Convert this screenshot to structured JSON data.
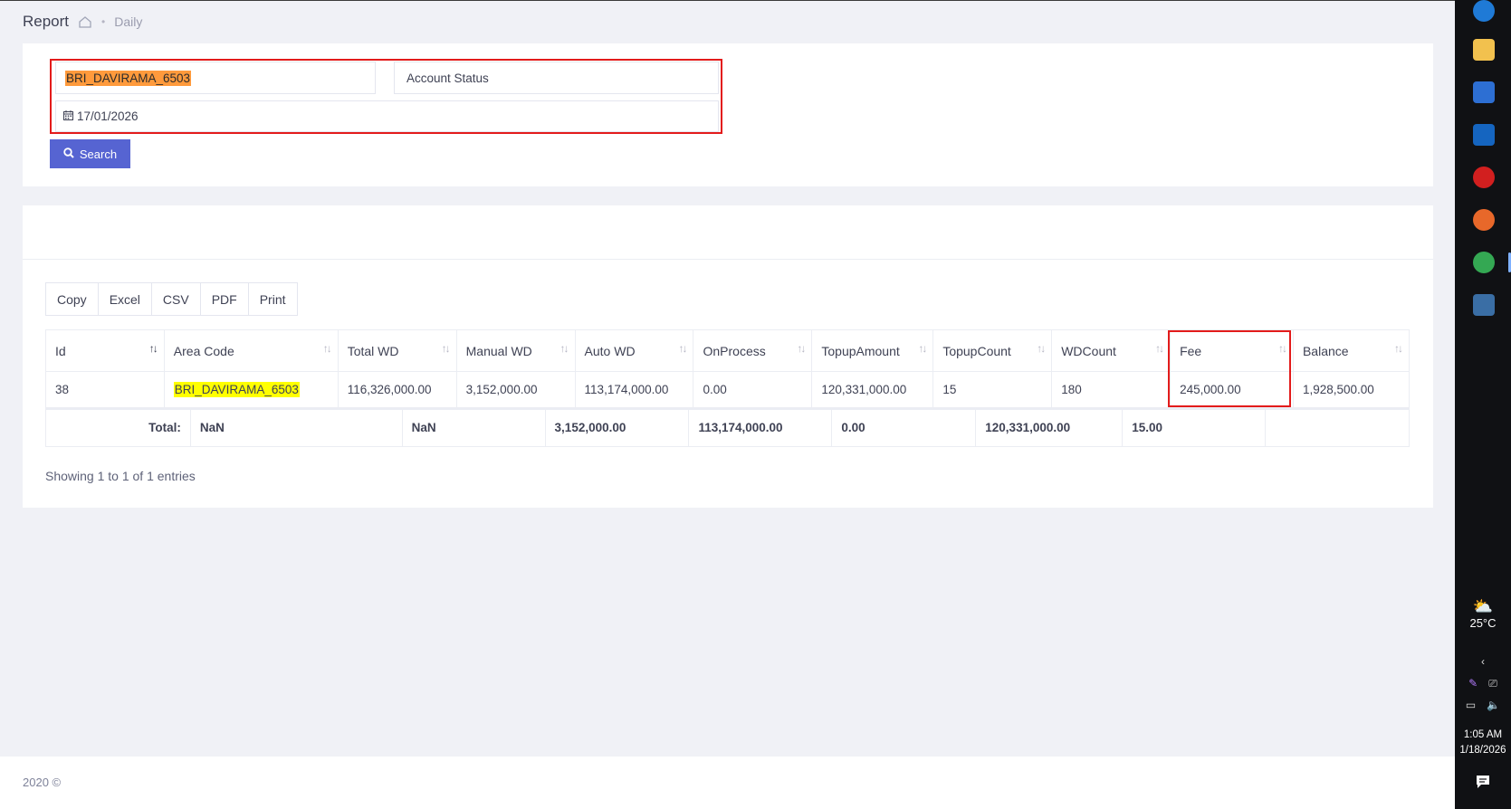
{
  "header": {
    "title": "Report",
    "breadcrumb": "Daily"
  },
  "filters": {
    "area_code": "BRI_DAVIRAMA_6503",
    "account_status": "Account Status",
    "date": "17/01/2026",
    "search_label": "Search"
  },
  "export_buttons": [
    "Copy",
    "Excel",
    "CSV",
    "PDF",
    "Print"
  ],
  "table": {
    "columns": [
      "Id",
      "Area Code",
      "Total WD",
      "Manual WD",
      "Auto WD",
      "OnProcess",
      "TopupAmount",
      "TopupCount",
      "WDCount",
      "Fee",
      "Balance"
    ],
    "rows": [
      [
        "38",
        "BRI_DAVIRAMA_6503",
        "116,326,000.00",
        "3,152,000.00",
        "113,174,000.00",
        "0.00",
        "120,331,000.00",
        "15",
        "180",
        "245,000.00",
        "1,928,500.00"
      ]
    ],
    "totals": {
      "label": "Total:",
      "values": [
        "NaN",
        "NaN",
        "3,152,000.00",
        "113,174,000.00",
        "0.00",
        "120,331,000.00",
        "15.00",
        ""
      ]
    },
    "info": "Showing 1 to 1 of 1 entries"
  },
  "footer": {
    "text": "2020 ©"
  },
  "taskbar": {
    "weather_temp": "25°C",
    "time": "1:05 AM",
    "date": "1/18/2026"
  },
  "colors": {
    "accent": "#5664d2",
    "highlight_box": "#e31b1b",
    "search_highlight_orange": "#ff9a3c",
    "search_highlight_yellow": "#ffff00"
  }
}
